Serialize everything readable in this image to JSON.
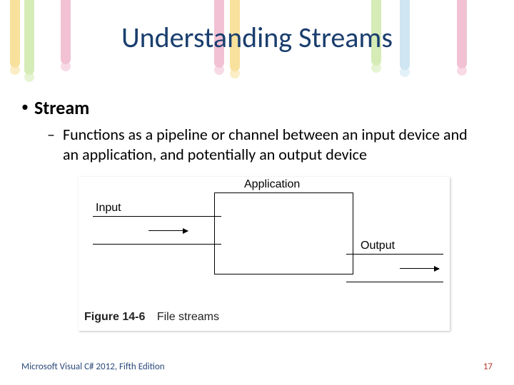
{
  "title": "Understanding Streams",
  "bullets": {
    "level1": "Stream",
    "level2": "Functions as a pipeline or channel between an input device and an application, and potentially an output device"
  },
  "diagram": {
    "application_label": "Application",
    "input_label": "Input",
    "output_label": "Output"
  },
  "figure": {
    "number": "Figure 14-6",
    "caption": "File streams"
  },
  "footer": {
    "left": "Microsoft Visual C# 2012, Fifth Edition",
    "page": "17"
  }
}
